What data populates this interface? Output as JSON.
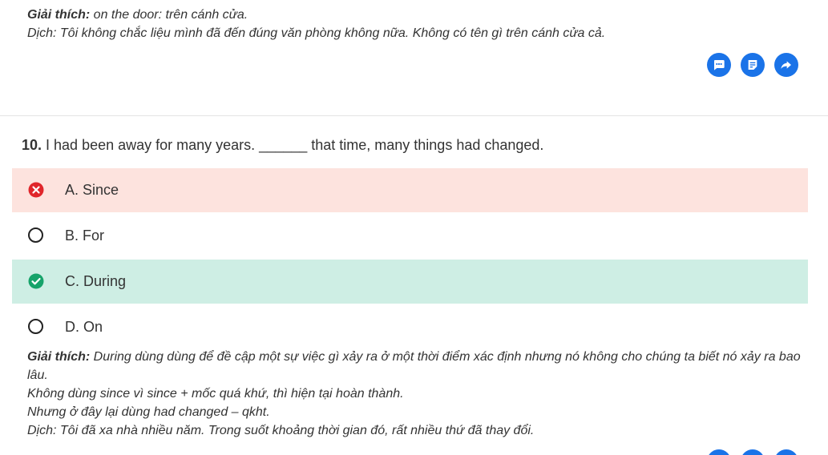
{
  "prev_explanation": {
    "label": "Giải thích:",
    "text": " on the door: trên cánh cửa.",
    "translation": "Dịch: Tôi không chắc liệu mình đã đến đúng văn phòng không nữa. Không có tên gì trên cánh cửa cả."
  },
  "actions": [
    {
      "name": "comment",
      "icon": "chat-bubble-icon"
    },
    {
      "name": "note",
      "icon": "note-icon"
    },
    {
      "name": "share",
      "icon": "share-arrow-icon"
    }
  ],
  "question": {
    "number": "10.",
    "text": " I had been away for many years. ______ that time, many things had changed."
  },
  "options": [
    {
      "label": "A. Since",
      "state": "wrong"
    },
    {
      "label": "B. For",
      "state": "none"
    },
    {
      "label": "C. During",
      "state": "correct"
    },
    {
      "label": "D. On",
      "state": "none"
    }
  ],
  "explanation": {
    "label": "Giải thích:",
    "line1": " During dùng dùng để đề cập một sự việc gì xảy ra ở một thời điểm xác định nhưng nó không cho chúng ta biết nó xảy ra bao lâu.",
    "line2": "Không dùng since vì since + mốc quá khứ, thì hiện tại hoàn thành.",
    "line3": "Nhưng ở đây lại dùng had changed – qkht.",
    "line4": "Dịch: Tôi đã xa nhà nhiều năm. Trong suốt khoảng thời gian đó, rất nhiều thứ đã thay đổi."
  },
  "colors": {
    "accent": "#1a73e8",
    "wrong_bg": "#fde3de",
    "wrong_icon": "#e0262b",
    "correct_bg": "#ceeee4",
    "correct_icon": "#16a36a"
  }
}
